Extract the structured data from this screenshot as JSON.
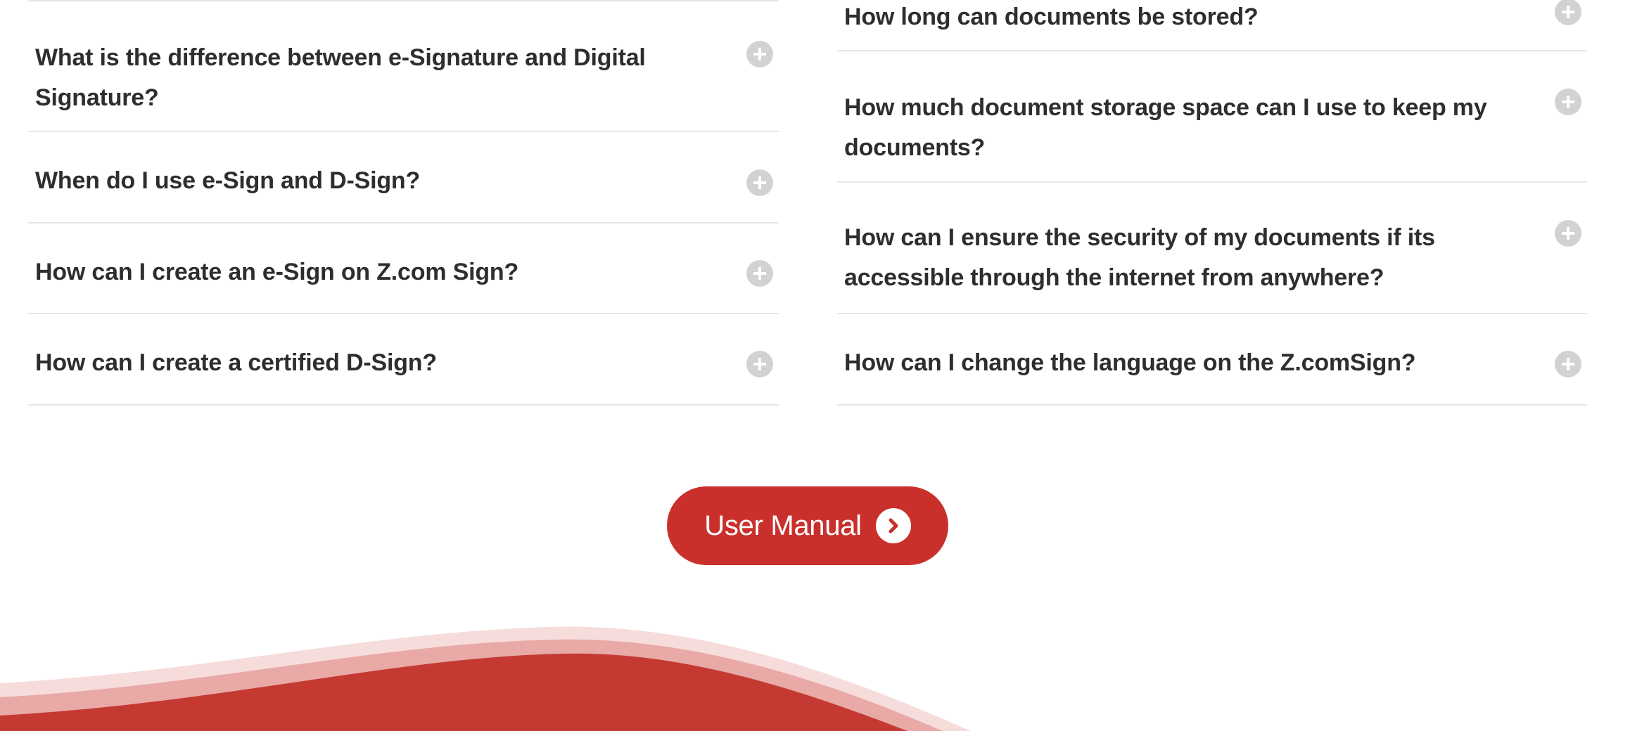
{
  "faq": {
    "left": [
      {
        "question": "What is the difference between e-Signature and Digital Signature?"
      },
      {
        "question": "When do I use e-Sign and D-Sign?"
      },
      {
        "question": "How can I create an e-Sign on Z.com Sign?"
      },
      {
        "question": "How can I create a certified D-Sign?"
      }
    ],
    "right": [
      {
        "question": "How long can documents be stored?"
      },
      {
        "question": "How much document storage space can I use to keep my documents?"
      },
      {
        "question": "How can I ensure the security of my documents if its accessible through the internet from anywhere?"
      },
      {
        "question": "How can I change the language on the Z.comSign?"
      }
    ]
  },
  "user_manual": {
    "label": "User Manual",
    "icon": "chevron-right-circle-icon"
  },
  "colors": {
    "accent": "#c9302c",
    "wave_light": "#f6dcdb",
    "wave_mid": "#e8a9a7",
    "wave_dark": "#c43a33",
    "toggle": "#d2d2d2",
    "divider": "#e6e6e6",
    "text": "#2e2e2e"
  }
}
